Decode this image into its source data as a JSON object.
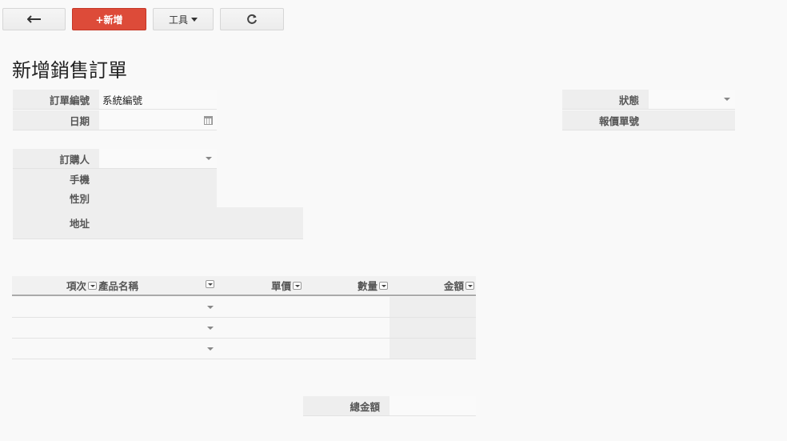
{
  "toolbar": {
    "back_icon": "arrow-left-icon",
    "new_label": "+新增",
    "tools_label": "工具",
    "refresh_icon": "refresh-icon"
  },
  "page": {
    "title": "新增銷售訂單"
  },
  "form": {
    "order_no_label": "訂單編號",
    "order_no_value": "系統編號",
    "date_label": "日期",
    "date_value": "",
    "buyer_label": "訂購人",
    "buyer_value": "",
    "phone_label": "手機",
    "phone_value": "",
    "gender_label": "性別",
    "gender_value": "",
    "address_label": "地址",
    "address_value": "",
    "status_label": "狀態",
    "status_value": "",
    "quote_no_label": "報價單號",
    "quote_no_value": ""
  },
  "table": {
    "columns": [
      "項次",
      "產品名稱",
      "單價",
      "數量",
      "金額"
    ],
    "rows": [
      {
        "index": "",
        "product": "",
        "price": "",
        "qty": "",
        "amount": ""
      },
      {
        "index": "",
        "product": "",
        "price": "",
        "qty": "",
        "amount": ""
      },
      {
        "index": "",
        "product": "",
        "price": "",
        "qty": "",
        "amount": ""
      }
    ]
  },
  "total": {
    "label": "總金額",
    "value": ""
  },
  "colors": {
    "accent": "#dd4b39",
    "label_bg": "#eeeeee",
    "page_bg": "#f9f9f9"
  }
}
